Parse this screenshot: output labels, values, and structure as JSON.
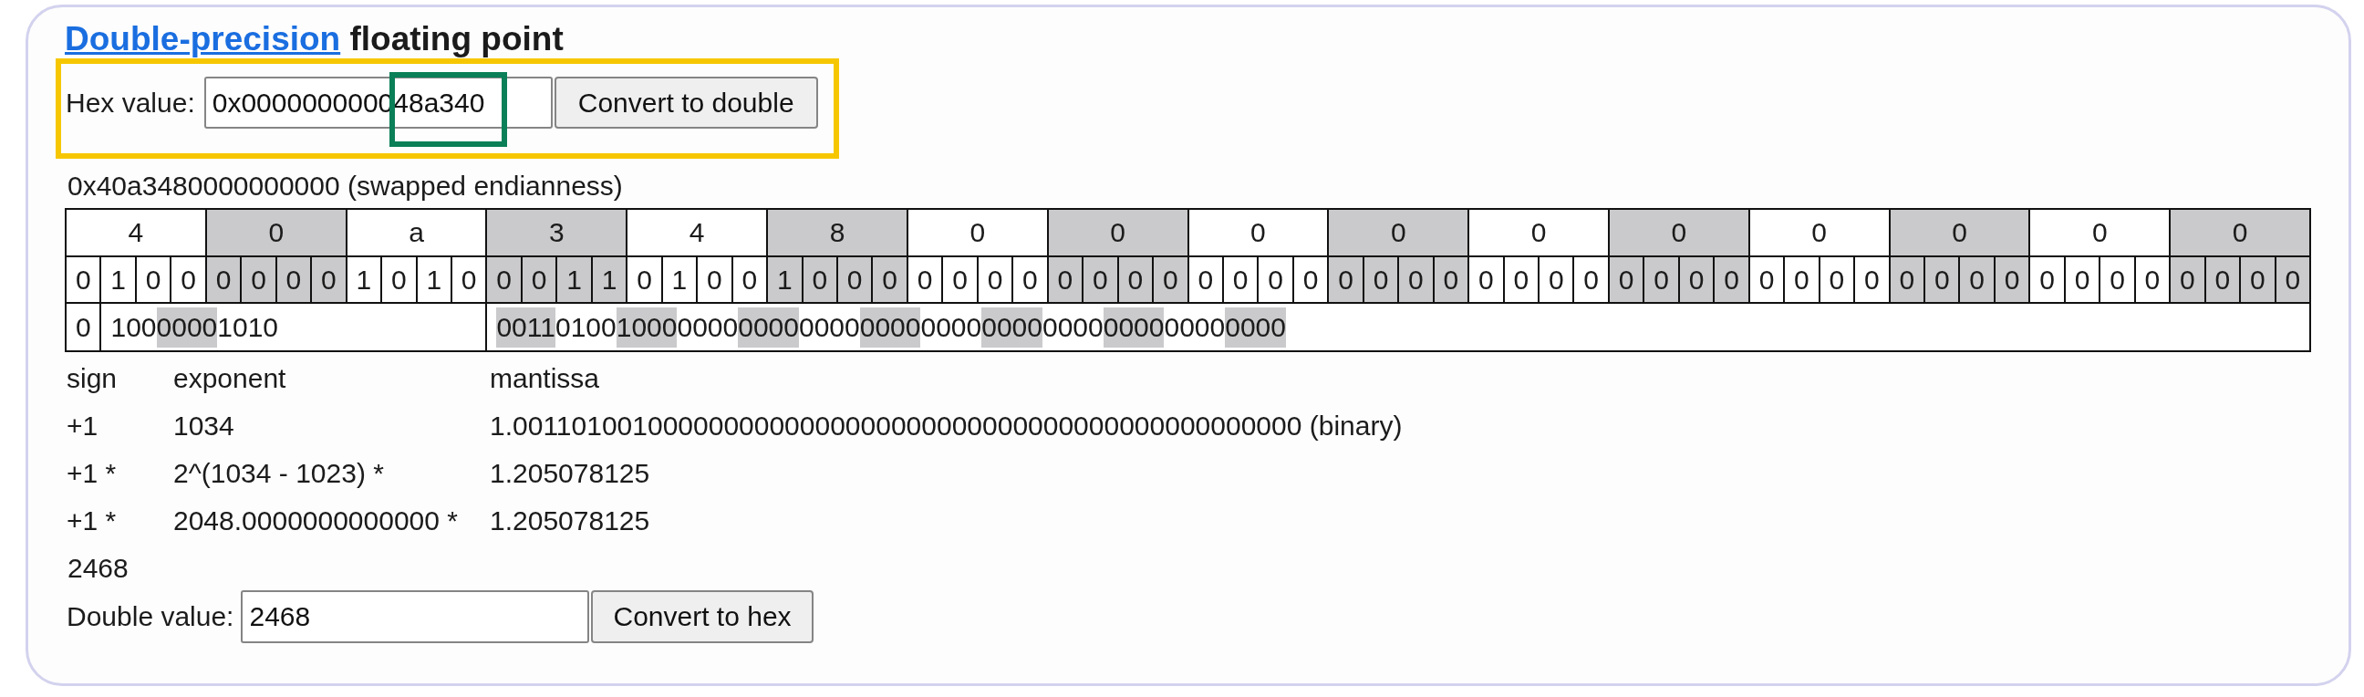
{
  "title": {
    "link": "Double-precision",
    "text": "floating point"
  },
  "hex_form": {
    "label": "Hex value:",
    "value": "0x000000000048a340",
    "button": "Convert to double",
    "highlighted": true,
    "value_highlighted": true
  },
  "swapped": "0x40a3480000000000 (swapped endianness)",
  "bit_table": {
    "hex_row": [
      {
        "digit": "4",
        "shaded": false
      },
      {
        "digit": "0",
        "shaded": true
      },
      {
        "digit": "a",
        "shaded": false
      },
      {
        "digit": "3",
        "shaded": true
      },
      {
        "digit": "4",
        "shaded": false
      },
      {
        "digit": "8",
        "shaded": true
      },
      {
        "digit": "0",
        "shaded": false
      },
      {
        "digit": "0",
        "shaded": true
      },
      {
        "digit": "0",
        "shaded": false
      },
      {
        "digit": "0",
        "shaded": true
      },
      {
        "digit": "0",
        "shaded": false
      },
      {
        "digit": "0",
        "shaded": true
      },
      {
        "digit": "0",
        "shaded": false
      },
      {
        "digit": "0",
        "shaded": true
      },
      {
        "digit": "0",
        "shaded": false
      },
      {
        "digit": "0",
        "shaded": true
      }
    ],
    "bit_row": [
      {
        "bit": "0",
        "shaded": false
      },
      {
        "bit": "1",
        "shaded": false
      },
      {
        "bit": "0",
        "shaded": false
      },
      {
        "bit": "0",
        "shaded": false
      },
      {
        "bit": "0",
        "shaded": true
      },
      {
        "bit": "0",
        "shaded": true
      },
      {
        "bit": "0",
        "shaded": true
      },
      {
        "bit": "0",
        "shaded": true
      },
      {
        "bit": "1",
        "shaded": false
      },
      {
        "bit": "0",
        "shaded": false
      },
      {
        "bit": "1",
        "shaded": false
      },
      {
        "bit": "0",
        "shaded": false
      },
      {
        "bit": "0",
        "shaded": true
      },
      {
        "bit": "0",
        "shaded": true
      },
      {
        "bit": "1",
        "shaded": true
      },
      {
        "bit": "1",
        "shaded": true
      },
      {
        "bit": "0",
        "shaded": false
      },
      {
        "bit": "1",
        "shaded": false
      },
      {
        "bit": "0",
        "shaded": false
      },
      {
        "bit": "0",
        "shaded": false
      },
      {
        "bit": "1",
        "shaded": true
      },
      {
        "bit": "0",
        "shaded": true
      },
      {
        "bit": "0",
        "shaded": true
      },
      {
        "bit": "0",
        "shaded": true
      },
      {
        "bit": "0",
        "shaded": false
      },
      {
        "bit": "0",
        "shaded": false
      },
      {
        "bit": "0",
        "shaded": false
      },
      {
        "bit": "0",
        "shaded": false
      },
      {
        "bit": "0",
        "shaded": true
      },
      {
        "bit": "0",
        "shaded": true
      },
      {
        "bit": "0",
        "shaded": true
      },
      {
        "bit": "0",
        "shaded": true
      },
      {
        "bit": "0",
        "shaded": false
      },
      {
        "bit": "0",
        "shaded": false
      },
      {
        "bit": "0",
        "shaded": false
      },
      {
        "bit": "0",
        "shaded": false
      },
      {
        "bit": "0",
        "shaded": true
      },
      {
        "bit": "0",
        "shaded": true
      },
      {
        "bit": "0",
        "shaded": true
      },
      {
        "bit": "0",
        "shaded": true
      },
      {
        "bit": "0",
        "shaded": false
      },
      {
        "bit": "0",
        "shaded": false
      },
      {
        "bit": "0",
        "shaded": false
      },
      {
        "bit": "0",
        "shaded": false
      },
      {
        "bit": "0",
        "shaded": true
      },
      {
        "bit": "0",
        "shaded": true
      },
      {
        "bit": "0",
        "shaded": true
      },
      {
        "bit": "0",
        "shaded": true
      },
      {
        "bit": "0",
        "shaded": false
      },
      {
        "bit": "0",
        "shaded": false
      },
      {
        "bit": "0",
        "shaded": false
      },
      {
        "bit": "0",
        "shaded": false
      },
      {
        "bit": "0",
        "shaded": true
      },
      {
        "bit": "0",
        "shaded": true
      },
      {
        "bit": "0",
        "shaded": true
      },
      {
        "bit": "0",
        "shaded": true
      },
      {
        "bit": "0",
        "shaded": false
      },
      {
        "bit": "0",
        "shaded": false
      },
      {
        "bit": "0",
        "shaded": false
      },
      {
        "bit": "0",
        "shaded": false
      },
      {
        "bit": "0",
        "shaded": true
      },
      {
        "bit": "0",
        "shaded": true
      },
      {
        "bit": "0",
        "shaded": true
      },
      {
        "bit": "0",
        "shaded": true
      }
    ],
    "sign": "0",
    "exponent": [
      {
        "text": "100",
        "shaded": false
      },
      {
        "text": "0000",
        "shaded": true
      },
      {
        "text": "1010",
        "shaded": false
      }
    ],
    "mantissa": [
      {
        "text": "0011",
        "shaded": true
      },
      {
        "text": "0100",
        "shaded": false
      },
      {
        "text": "1000",
        "shaded": true
      },
      {
        "text": "0000",
        "shaded": false
      },
      {
        "text": "0000",
        "shaded": true
      },
      {
        "text": "0000",
        "shaded": false
      },
      {
        "text": "0000",
        "shaded": true
      },
      {
        "text": "0000",
        "shaded": false
      },
      {
        "text": "0000",
        "shaded": true
      },
      {
        "text": "0000",
        "shaded": false
      },
      {
        "text": "0000",
        "shaded": true
      },
      {
        "text": "0000",
        "shaded": false
      },
      {
        "text": "0000",
        "shaded": true
      }
    ]
  },
  "breakdown": {
    "columns": [
      "sign",
      "exponent",
      "mantissa"
    ],
    "rows": [
      {
        "sign": "+1",
        "exponent": "1034",
        "mantissa": "1.0011010010000000000000000000000000000000000000000000 (binary)"
      },
      {
        "sign": "+1 *",
        "exponent": "2^(1034 - 1023) *",
        "mantissa": "1.205078125"
      },
      {
        "sign": "+1 *",
        "exponent": "2048.0000000000000 *",
        "mantissa": "1.205078125"
      }
    ]
  },
  "result": "2468",
  "double_form": {
    "label": "Double value:",
    "value": "2468",
    "button": "Convert to hex"
  }
}
